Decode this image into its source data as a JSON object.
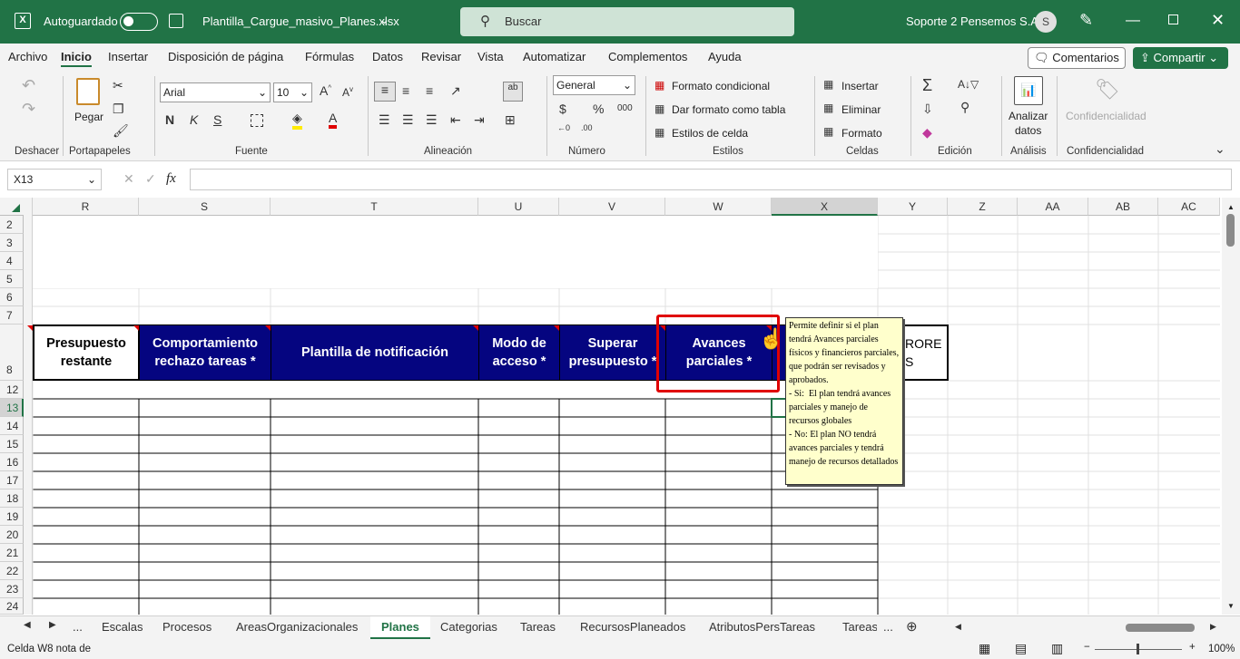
{
  "titlebar": {
    "autosave_label": "Autoguardado",
    "filename": "Plantilla_Cargue_masivo_Planes.xlsx",
    "search_placeholder": "Buscar",
    "user_name": "Soporte 2 Pensemos S.A.",
    "avatar_initial": "S"
  },
  "menu": [
    "Archivo",
    "Inicio",
    "Insertar",
    "Disposición de página",
    "Fórmulas",
    "Datos",
    "Revisar",
    "Vista",
    "Automatizar",
    "Complementos",
    "Ayuda"
  ],
  "menu_active": "Inicio",
  "comments_label": "Comentarios",
  "share_label": "Compartir",
  "ribbon": {
    "groups": [
      "Deshacer",
      "Portapapeles",
      "Fuente",
      "Alineación",
      "Número",
      "Estilos",
      "Celdas",
      "Edición",
      "Análisis",
      "Confidencialidad"
    ],
    "paste_label": "Pegar",
    "font_name": "Arial",
    "font_size": "10",
    "bold": "N",
    "italic": "K",
    "underline": "S",
    "number_format": "General",
    "conditional_format": "Formato condicional",
    "format_as_table": "Dar formato como tabla",
    "cell_styles": "Estilos de celda",
    "insert": "Insertar",
    "delete": "Eliminar",
    "format": "Formato",
    "analyze_line1": "Analizar",
    "analyze_line2": "datos",
    "confidentiality": "Confidencialidad"
  },
  "formula_bar": {
    "name_box": "X13",
    "fx": "fx",
    "value": ""
  },
  "columns": [
    "R",
    "S",
    "T",
    "U",
    "V",
    "W",
    "X",
    "Y",
    "Z",
    "AA",
    "AB",
    "AC"
  ],
  "rows": [
    "2",
    "3",
    "4",
    "5",
    "6",
    "7",
    "8",
    "12",
    "13",
    "14",
    "15",
    "16",
    "17",
    "18",
    "19",
    "20",
    "21",
    "22",
    "23",
    "24"
  ],
  "selected_column": "X",
  "selected_row": "13",
  "headers": [
    "Presupuesto restante",
    "Comportamiento rechazo tareas *",
    "Plantilla de notificación",
    "Modo de acceso *",
    "Superar presupuesto *",
    "Avances parciales *"
  ],
  "partial_header": "RORE\nS",
  "tooltip": "Permite definir si el plan tendrá Avances parciales físicos y financieros parciales, que podrán ser revisados y aprobados.\n- Si:  El plan tendrá avances parciales y manejo de recursos globales\n- No: El plan NO tendrá avances parciales y tendrá manejo de recursos detallados",
  "sheet_tabs": [
    "Escalas",
    "Procesos",
    "AreasOrganizacionales",
    "Planes",
    "Categorias",
    "Tareas",
    "RecursosPlaneados",
    "AtributosPersTareas",
    "Tareas"
  ],
  "active_sheet": "Planes",
  "status": {
    "left": "Celda W8 nota de",
    "zoom": "100%"
  }
}
